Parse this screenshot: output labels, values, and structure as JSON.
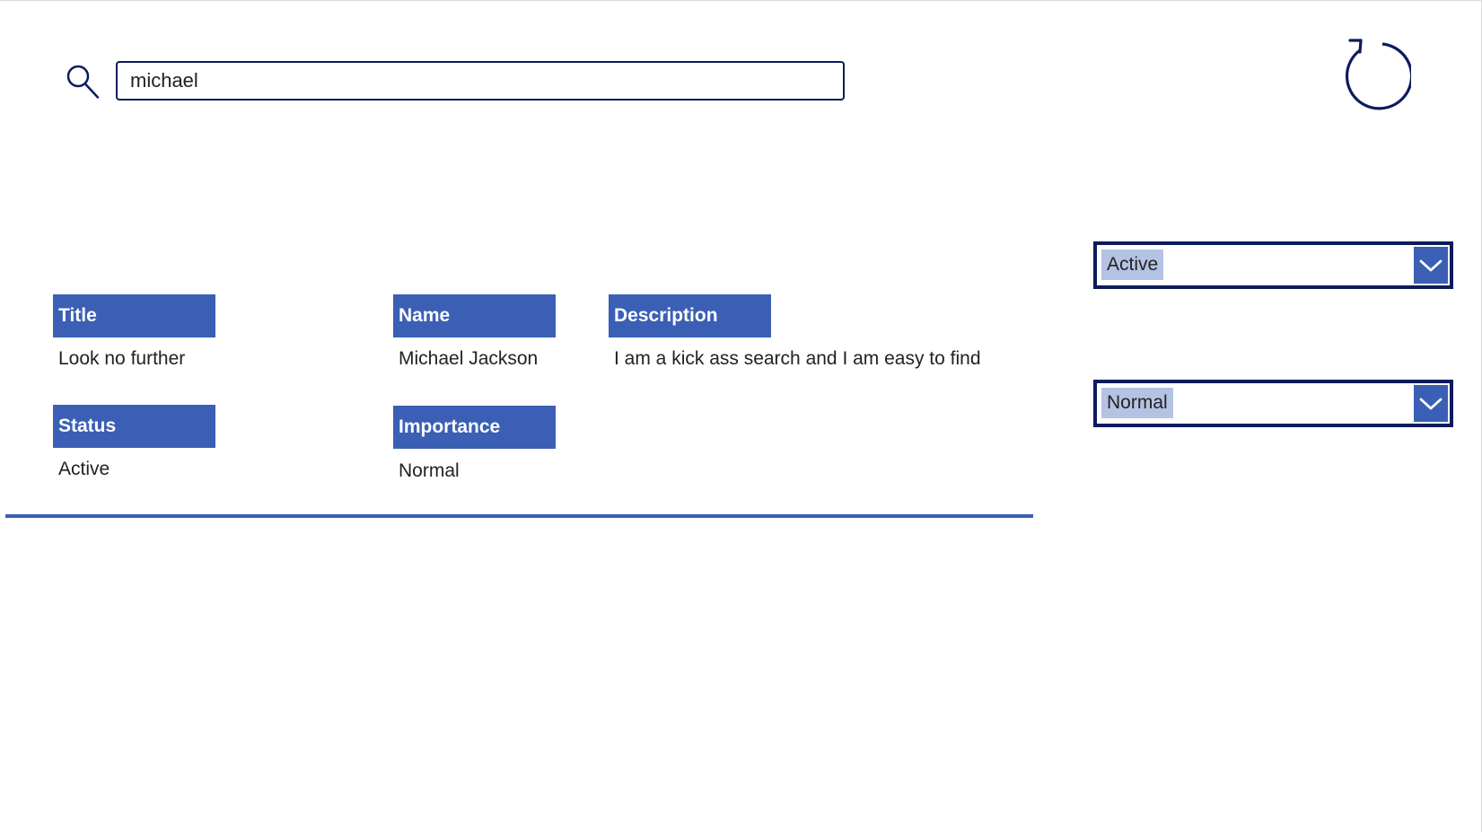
{
  "search": {
    "value": "michael",
    "icon": "search-icon"
  },
  "toolbar": {
    "reset_icon": "refresh-icon"
  },
  "gallery": {
    "item": {
      "title_label": "Title",
      "title_value": "Look no further",
      "name_label": "Name",
      "name_value": "Michael Jackson",
      "description_label": "Description",
      "description_value": "I am a kick ass search and I am easy to find",
      "status_label": "Status",
      "status_value": "Active",
      "importance_label": "Importance",
      "importance_value": "Normal"
    }
  },
  "filters": {
    "status_selected": "Active",
    "importance_selected": "Normal"
  },
  "colors": {
    "accent": "#3a5fb5",
    "border_dark": "#0d1b5e",
    "selection_highlight": "#b4c3e4",
    "label_text": "#ffffff"
  }
}
